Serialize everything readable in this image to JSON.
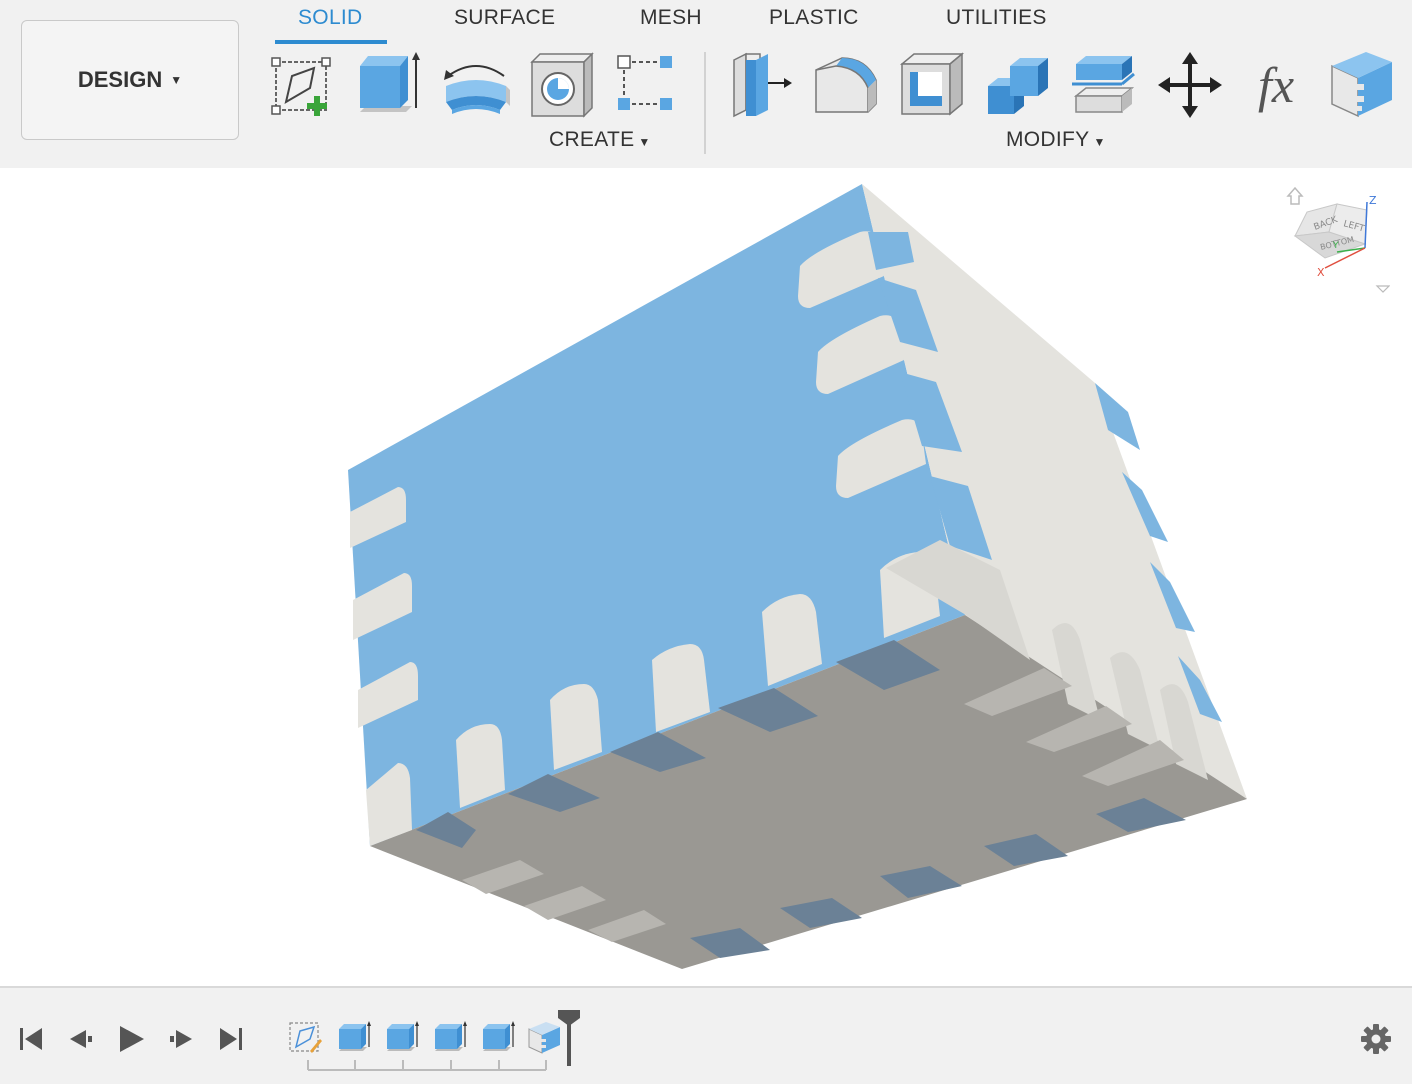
{
  "workspace": {
    "label": "DESIGN"
  },
  "tabs": [
    {
      "label": "SOLID",
      "active": true
    },
    {
      "label": "SURFACE",
      "active": false
    },
    {
      "label": "MESH",
      "active": false
    },
    {
      "label": "PLASTIC",
      "active": false
    },
    {
      "label": "UTILITIES",
      "active": false
    }
  ],
  "create_group": {
    "label": "CREATE",
    "tools": [
      "create-sketch-icon",
      "extrude-icon",
      "revolve-icon",
      "hole-icon",
      "pattern-icon"
    ]
  },
  "modify_group": {
    "label": "MODIFY",
    "tools": [
      "press-pull-icon",
      "fillet-icon",
      "shell-icon",
      "combine-icon",
      "offset-face-icon",
      "move-icon",
      "parameters-icon",
      "box-joint-icon"
    ]
  },
  "parameters_label": "fx",
  "viewcube": {
    "faces": [
      "BACK",
      "LEFT",
      "BOTTOM"
    ],
    "axes": [
      "Z",
      "Y",
      "X"
    ]
  },
  "timeline": {
    "controls": [
      "go-to-start",
      "step-back",
      "play",
      "step-forward",
      "go-to-end"
    ],
    "features": [
      "sketch",
      "extrude",
      "extrude",
      "extrude",
      "extrude",
      "box-joint"
    ]
  },
  "colors": {
    "accent": "#2d8bd0",
    "model_blue": "#7db5e0",
    "model_white": "#e4e3de",
    "model_gray": "#9a9893",
    "slot_dark": "#6b8196"
  }
}
